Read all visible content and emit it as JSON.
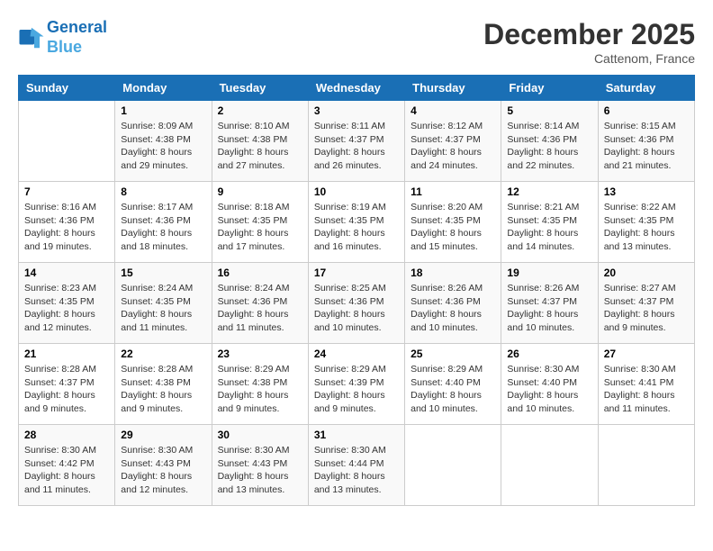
{
  "header": {
    "logo_line1": "General",
    "logo_line2": "Blue",
    "month_title": "December 2025",
    "location": "Cattenom, France"
  },
  "days_of_week": [
    "Sunday",
    "Monday",
    "Tuesday",
    "Wednesday",
    "Thursday",
    "Friday",
    "Saturday"
  ],
  "weeks": [
    [
      {
        "num": "",
        "info": ""
      },
      {
        "num": "1",
        "info": "Sunrise: 8:09 AM\nSunset: 4:38 PM\nDaylight: 8 hours\nand 29 minutes."
      },
      {
        "num": "2",
        "info": "Sunrise: 8:10 AM\nSunset: 4:38 PM\nDaylight: 8 hours\nand 27 minutes."
      },
      {
        "num": "3",
        "info": "Sunrise: 8:11 AM\nSunset: 4:37 PM\nDaylight: 8 hours\nand 26 minutes."
      },
      {
        "num": "4",
        "info": "Sunrise: 8:12 AM\nSunset: 4:37 PM\nDaylight: 8 hours\nand 24 minutes."
      },
      {
        "num": "5",
        "info": "Sunrise: 8:14 AM\nSunset: 4:36 PM\nDaylight: 8 hours\nand 22 minutes."
      },
      {
        "num": "6",
        "info": "Sunrise: 8:15 AM\nSunset: 4:36 PM\nDaylight: 8 hours\nand 21 minutes."
      }
    ],
    [
      {
        "num": "7",
        "info": "Sunrise: 8:16 AM\nSunset: 4:36 PM\nDaylight: 8 hours\nand 19 minutes."
      },
      {
        "num": "8",
        "info": "Sunrise: 8:17 AM\nSunset: 4:36 PM\nDaylight: 8 hours\nand 18 minutes."
      },
      {
        "num": "9",
        "info": "Sunrise: 8:18 AM\nSunset: 4:35 PM\nDaylight: 8 hours\nand 17 minutes."
      },
      {
        "num": "10",
        "info": "Sunrise: 8:19 AM\nSunset: 4:35 PM\nDaylight: 8 hours\nand 16 minutes."
      },
      {
        "num": "11",
        "info": "Sunrise: 8:20 AM\nSunset: 4:35 PM\nDaylight: 8 hours\nand 15 minutes."
      },
      {
        "num": "12",
        "info": "Sunrise: 8:21 AM\nSunset: 4:35 PM\nDaylight: 8 hours\nand 14 minutes."
      },
      {
        "num": "13",
        "info": "Sunrise: 8:22 AM\nSunset: 4:35 PM\nDaylight: 8 hours\nand 13 minutes."
      }
    ],
    [
      {
        "num": "14",
        "info": "Sunrise: 8:23 AM\nSunset: 4:35 PM\nDaylight: 8 hours\nand 12 minutes."
      },
      {
        "num": "15",
        "info": "Sunrise: 8:24 AM\nSunset: 4:35 PM\nDaylight: 8 hours\nand 11 minutes."
      },
      {
        "num": "16",
        "info": "Sunrise: 8:24 AM\nSunset: 4:36 PM\nDaylight: 8 hours\nand 11 minutes."
      },
      {
        "num": "17",
        "info": "Sunrise: 8:25 AM\nSunset: 4:36 PM\nDaylight: 8 hours\nand 10 minutes."
      },
      {
        "num": "18",
        "info": "Sunrise: 8:26 AM\nSunset: 4:36 PM\nDaylight: 8 hours\nand 10 minutes."
      },
      {
        "num": "19",
        "info": "Sunrise: 8:26 AM\nSunset: 4:37 PM\nDaylight: 8 hours\nand 10 minutes."
      },
      {
        "num": "20",
        "info": "Sunrise: 8:27 AM\nSunset: 4:37 PM\nDaylight: 8 hours\nand 9 minutes."
      }
    ],
    [
      {
        "num": "21",
        "info": "Sunrise: 8:28 AM\nSunset: 4:37 PM\nDaylight: 8 hours\nand 9 minutes."
      },
      {
        "num": "22",
        "info": "Sunrise: 8:28 AM\nSunset: 4:38 PM\nDaylight: 8 hours\nand 9 minutes."
      },
      {
        "num": "23",
        "info": "Sunrise: 8:29 AM\nSunset: 4:38 PM\nDaylight: 8 hours\nand 9 minutes."
      },
      {
        "num": "24",
        "info": "Sunrise: 8:29 AM\nSunset: 4:39 PM\nDaylight: 8 hours\nand 9 minutes."
      },
      {
        "num": "25",
        "info": "Sunrise: 8:29 AM\nSunset: 4:40 PM\nDaylight: 8 hours\nand 10 minutes."
      },
      {
        "num": "26",
        "info": "Sunrise: 8:30 AM\nSunset: 4:40 PM\nDaylight: 8 hours\nand 10 minutes."
      },
      {
        "num": "27",
        "info": "Sunrise: 8:30 AM\nSunset: 4:41 PM\nDaylight: 8 hours\nand 11 minutes."
      }
    ],
    [
      {
        "num": "28",
        "info": "Sunrise: 8:30 AM\nSunset: 4:42 PM\nDaylight: 8 hours\nand 11 minutes."
      },
      {
        "num": "29",
        "info": "Sunrise: 8:30 AM\nSunset: 4:43 PM\nDaylight: 8 hours\nand 12 minutes."
      },
      {
        "num": "30",
        "info": "Sunrise: 8:30 AM\nSunset: 4:43 PM\nDaylight: 8 hours\nand 13 minutes."
      },
      {
        "num": "31",
        "info": "Sunrise: 8:30 AM\nSunset: 4:44 PM\nDaylight: 8 hours\nand 13 minutes."
      },
      {
        "num": "",
        "info": ""
      },
      {
        "num": "",
        "info": ""
      },
      {
        "num": "",
        "info": ""
      }
    ]
  ]
}
